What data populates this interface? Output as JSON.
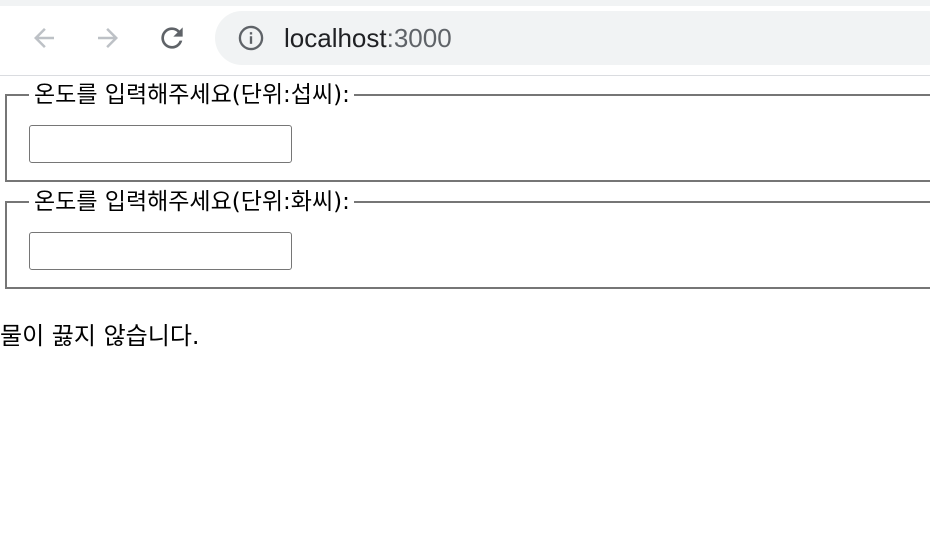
{
  "browser": {
    "url_host": "localhost",
    "url_port": ":3000",
    "icons": [
      "back-arrow-icon",
      "forward-arrow-icon",
      "reload-icon",
      "info-icon"
    ]
  },
  "form": {
    "celsius": {
      "legend": "온도를 입력해주세요(단위:섭씨):",
      "value": ""
    },
    "fahrenheit": {
      "legend": "온도를 입력해주세요(단위:화씨):",
      "value": ""
    }
  },
  "verdict": "물이 끓지 않습니다."
}
